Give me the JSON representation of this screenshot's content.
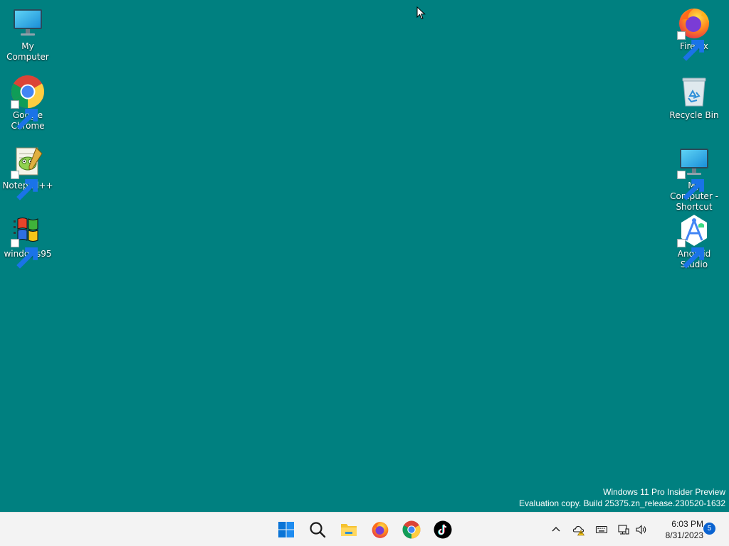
{
  "desktop": {
    "background_color": "#008080",
    "left_icons": [
      {
        "label": "My Computer",
        "icon": "monitor-icon",
        "shortcut": false
      },
      {
        "label": "Google Chrome",
        "icon": "chrome-icon",
        "shortcut": true
      },
      {
        "label": "Notepad++",
        "icon": "notepad-plus-plus-icon",
        "shortcut": true
      },
      {
        "label": "windows95",
        "icon": "windows95-logo-icon",
        "shortcut": true
      }
    ],
    "right_icons": [
      {
        "label": "Firefox",
        "icon": "firefox-icon",
        "shortcut": true
      },
      {
        "label": "Recycle Bin",
        "icon": "recycle-bin-icon",
        "shortcut": false
      },
      {
        "label": "My Computer - Shortcut",
        "icon": "monitor-icon",
        "shortcut": true
      },
      {
        "label": "Android Studio",
        "icon": "android-studio-icon",
        "shortcut": true
      }
    ]
  },
  "watermark": {
    "line1": "Windows 11 Pro Insider Preview",
    "line2": "Evaluation copy. Build 25375.zn_release.230520-1632"
  },
  "taskbar": {
    "apps": [
      {
        "name": "start-button",
        "icon": "windows-start-icon"
      },
      {
        "name": "search-button",
        "icon": "search-icon"
      },
      {
        "name": "file-explorer-button",
        "icon": "folder-icon"
      },
      {
        "name": "firefox-taskbar-button",
        "icon": "firefox-icon"
      },
      {
        "name": "chrome-taskbar-button",
        "icon": "chrome-icon"
      },
      {
        "name": "tiktok-taskbar-button",
        "icon": "tiktok-icon"
      }
    ],
    "tray": [
      {
        "name": "show-hidden-icons-button",
        "icon": "chevron-up-icon"
      },
      {
        "name": "onedrive-tray-button",
        "icon": "onedrive-warning-icon"
      },
      {
        "name": "keyboard-tray-button",
        "icon": "keyboard-icon"
      },
      {
        "name": "network-tray-button",
        "icon": "network-icon"
      },
      {
        "name": "volume-tray-button",
        "icon": "speaker-icon"
      }
    ],
    "clock": {
      "time": "6:03 PM",
      "date": "8/31/2023"
    },
    "notification_count": "5"
  }
}
